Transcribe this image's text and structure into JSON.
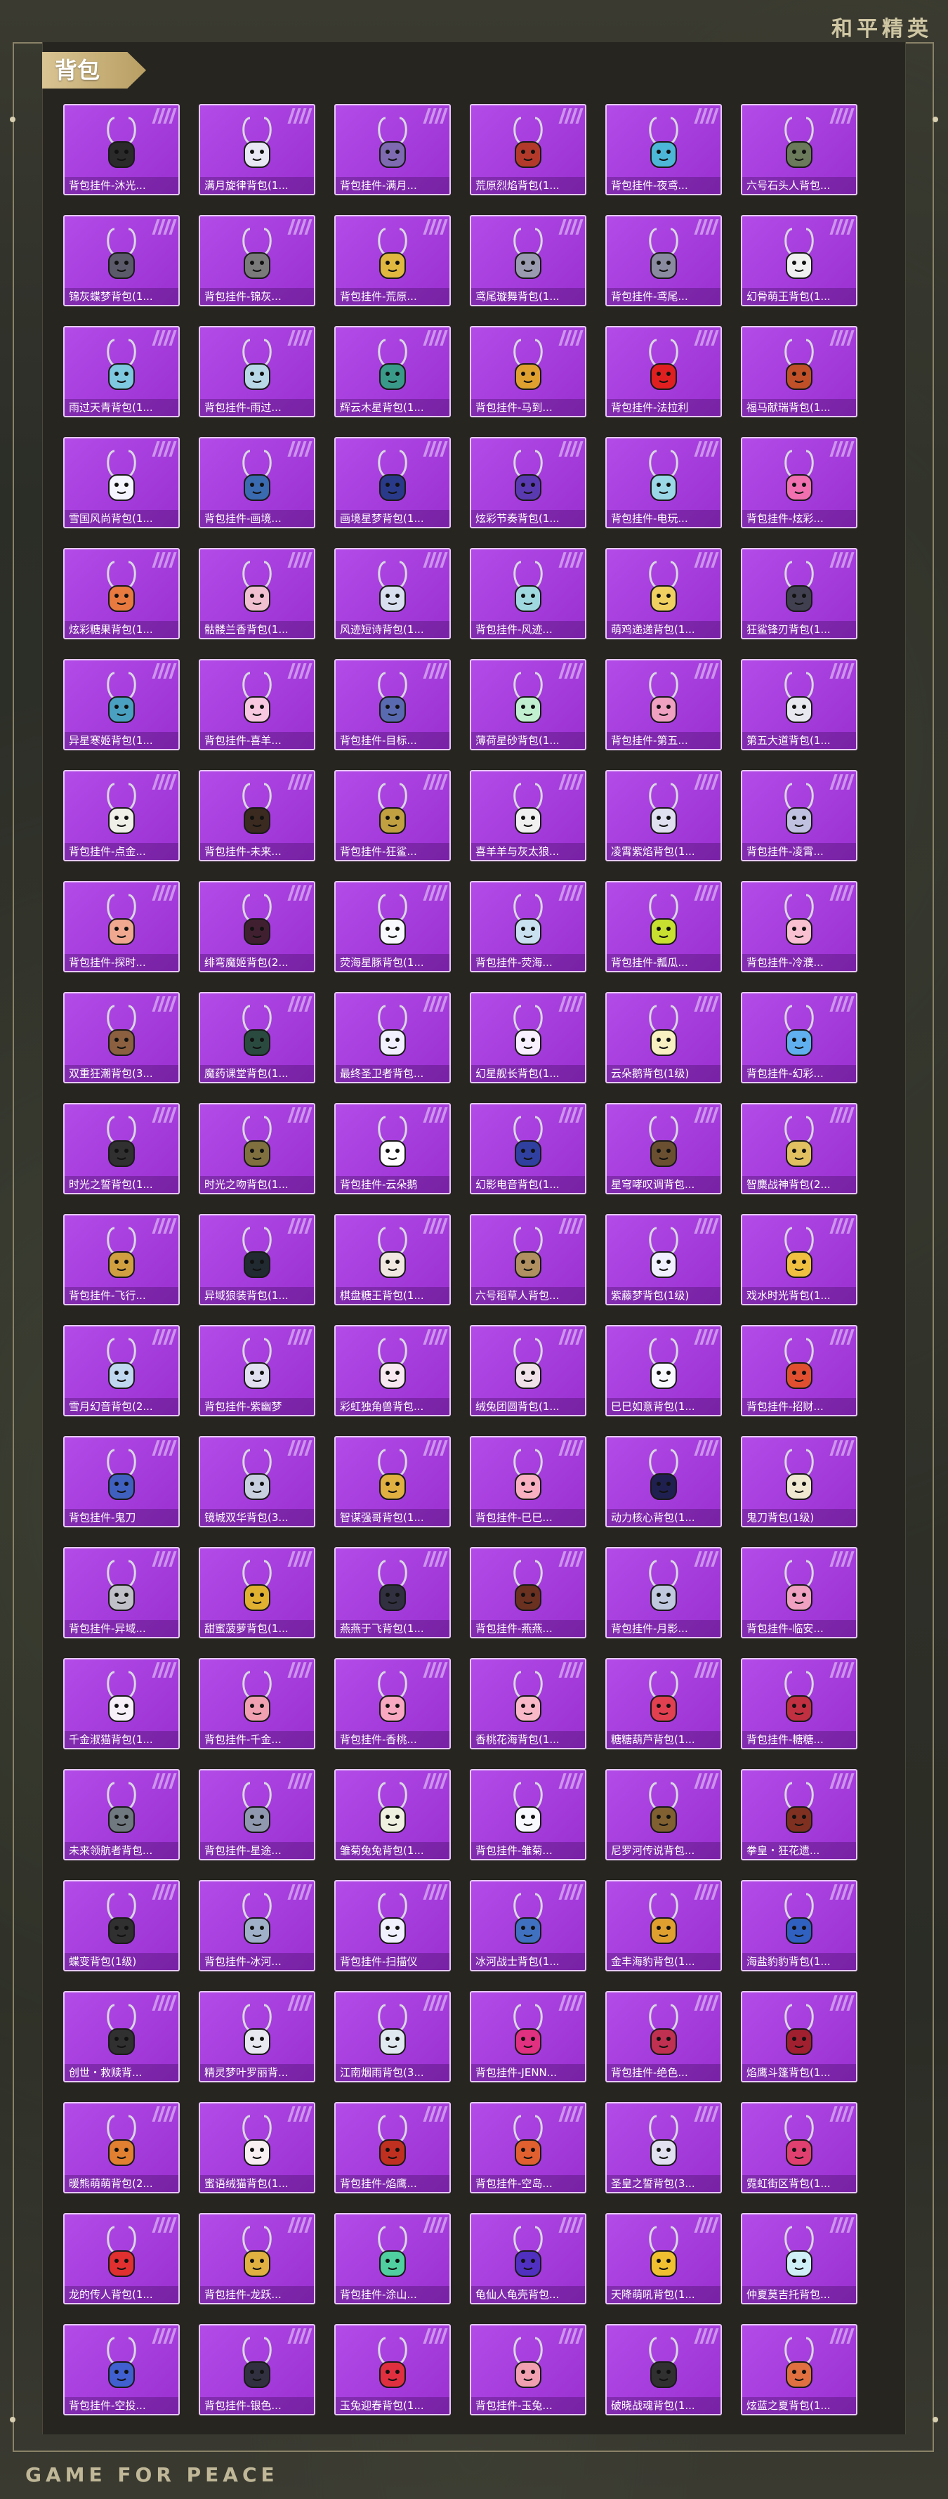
{
  "brand": {
    "cn_title": "和平精英",
    "en_footer": "GAME FOR PEACE"
  },
  "section": {
    "title": "背包"
  },
  "colors": {
    "card_purple": "#a53cdc",
    "card_border": "#e7c8f6",
    "title_gold": "#d9c493"
  },
  "items": [
    {
      "label": "背包挂件-沐光...",
      "icon": "cat-charm-icon",
      "tint": "#2a2a2a"
    },
    {
      "label": "满月旋律背包(1...",
      "icon": "moon-charm-icon",
      "tint": "#e8e8f5"
    },
    {
      "label": "背包挂件-满月...",
      "icon": "ring-charm-icon",
      "tint": "#7e6ab0"
    },
    {
      "label": "荒原烈焰背包(1...",
      "icon": "flame-backpack-icon",
      "tint": "#b33a2a"
    },
    {
      "label": "背包挂件-夜鸢...",
      "icon": "bird-charm-icon",
      "tint": "#4db7d8"
    },
    {
      "label": "六号石头人背包...",
      "icon": "stone-golem-icon",
      "tint": "#6a7a5a"
    },
    {
      "label": "锦灰蝶梦背包(1...",
      "icon": "butterfly-charm-icon",
      "tint": "#5a5a6a"
    },
    {
      "label": "背包挂件-锦灰...",
      "icon": "hook-charm-icon",
      "tint": "#7a7a7a"
    },
    {
      "label": "背包挂件-荒原...",
      "icon": "star-charm-icon",
      "tint": "#e0b840"
    },
    {
      "label": "鸢尾璇舞背包(1...",
      "icon": "blade-charm-icon",
      "tint": "#9a9ab0"
    },
    {
      "label": "背包挂件-鸢尾...",
      "icon": "feather-charm-icon",
      "tint": "#8a8aa0"
    },
    {
      "label": "幻骨萌王背包(1...",
      "icon": "skull-charm-icon",
      "tint": "#f0f0f0"
    },
    {
      "label": "雨过天青背包(1...",
      "icon": "shell-charm-icon",
      "tint": "#7ec8e0"
    },
    {
      "label": "背包挂件-雨过...",
      "icon": "sword-charm-icon",
      "tint": "#b8d8e8"
    },
    {
      "label": "辉云木星背包(1...",
      "icon": "bunny-charm-icon",
      "tint": "#3a9a8a"
    },
    {
      "label": "背包挂件-马到...",
      "icon": "horse-charm-icon",
      "tint": "#e0a030"
    },
    {
      "label": "背包挂件-法拉利",
      "icon": "ferrari-badge-icon",
      "tint": "#e02020"
    },
    {
      "label": "福马献瑞背包(1...",
      "icon": "horse-bag-icon",
      "tint": "#c05028"
    },
    {
      "label": "雪国风尚背包(1...",
      "icon": "snow-bunny-icon",
      "tint": "#f5f5ff"
    },
    {
      "label": "背包挂件-画境...",
      "icon": "brush-charm-icon",
      "tint": "#3a6ab0"
    },
    {
      "label": "画境星梦背包(1...",
      "icon": "starry-bag-icon",
      "tint": "#2a3a8a"
    },
    {
      "label": "炫彩节奏背包(1...",
      "icon": "rhythm-bag-icon",
      "tint": "#5a3ab0"
    },
    {
      "label": "背包挂件-电玩...",
      "icon": "gameboy-charm-icon",
      "tint": "#9ad8e8"
    },
    {
      "label": "背包挂件-炫彩...",
      "icon": "candy-charm-icon",
      "tint": "#f070b0"
    },
    {
      "label": "炫彩糖果背包(1...",
      "icon": "donut-bag-icon",
      "tint": "#e87a40"
    },
    {
      "label": "骷髅兰香背包(1...",
      "icon": "flower-bag-icon",
      "tint": "#f0c0d0"
    },
    {
      "label": "风迹短诗背包(1...",
      "icon": "poem-bag-icon",
      "tint": "#d8e0f0"
    },
    {
      "label": "背包挂件-风迹...",
      "icon": "crystal-charm-icon",
      "tint": "#a0d8e0"
    },
    {
      "label": "萌鸡递递背包(1...",
      "icon": "chick-bag-icon",
      "tint": "#f0d060"
    },
    {
      "label": "狂鲨锋刃背包(1...",
      "icon": "shark-bag-icon",
      "tint": "#404050"
    },
    {
      "label": "异星寒姬背包(1...",
      "icon": "ice-bag-icon",
      "tint": "#4aa0c0"
    },
    {
      "label": "背包挂件-喜羊...",
      "icon": "bow-charm-icon",
      "tint": "#f8c8e0"
    },
    {
      "label": "背包挂件-目标...",
      "icon": "target-charm-icon",
      "tint": "#5a6ab0"
    },
    {
      "label": "薄荷星砂背包(1...",
      "icon": "mint-bag-icon",
      "tint": "#c0f0d0"
    },
    {
      "label": "背包挂件-第五...",
      "icon": "pink-charm-icon",
      "tint": "#f0a0c0"
    },
    {
      "label": "第五大道背包(1...",
      "icon": "avenue-bag-icon",
      "tint": "#e8e8f0"
    },
    {
      "label": "背包挂件-点金...",
      "icon": "mask-charm-icon",
      "tint": "#f0f0e8"
    },
    {
      "label": "背包挂件-未来...",
      "icon": "pumpkin-charm-icon",
      "tint": "#3a2a20"
    },
    {
      "label": "背包挂件-狂鲨...",
      "icon": "fin-charm-icon",
      "tint": "#c0a040"
    },
    {
      "label": "喜羊羊与灰太狼...",
      "icon": "sheep-bag-icon",
      "tint": "#f0f0f0"
    },
    {
      "label": "凌霄紫焰背包(1...",
      "icon": "purple-bag-icon",
      "tint": "#e0e0f0"
    },
    {
      "label": "背包挂件-凌霄...",
      "icon": "flame-charm-icon",
      "tint": "#c0c0e0"
    },
    {
      "label": "背包挂件-探时...",
      "icon": "clock-charm-icon",
      "tint": "#f0a890"
    },
    {
      "label": "绯弯魔姬背包(2...",
      "icon": "witch-bag-icon",
      "tint": "#402030"
    },
    {
      "label": "荧海星豚背包(1...",
      "icon": "dolphin-bag-icon",
      "tint": "#f8f8ff"
    },
    {
      "label": "背包挂件-荧海...",
      "icon": "shell-charm-icon",
      "tint": "#c8e0f0"
    },
    {
      "label": "背包挂件-瓢瓜...",
      "icon": "popsicle-charm-icon",
      "tint": "#c8e030"
    },
    {
      "label": "背包挂件-冷濮...",
      "icon": "blossom-charm-icon",
      "tint": "#f8c0d0"
    },
    {
      "label": "双重狂潮背包(3...",
      "icon": "monkey-bag-icon",
      "tint": "#8a6040"
    },
    {
      "label": "魔药课堂背包(1...",
      "icon": "potion-bag-icon",
      "tint": "#2a4a40"
    },
    {
      "label": "最终圣卫者背包...",
      "icon": "guardian-bag-icon",
      "tint": "#f0f0ff"
    },
    {
      "label": "幻星舰长背包(1...",
      "icon": "captain-bag-icon",
      "tint": "#f8f0ff"
    },
    {
      "label": "云朵鹅背包(1级)",
      "icon": "goose-bag-icon",
      "tint": "#f8f0c0"
    },
    {
      "label": "背包挂件-幻彩...",
      "icon": "robot-charm-icon",
      "tint": "#60b0f0"
    },
    {
      "label": "时光之誓背包(1...",
      "icon": "time-bag-icon",
      "tint": "#303030"
    },
    {
      "label": "时光之吻背包(1...",
      "icon": "kiss-bag-icon",
      "tint": "#807040"
    },
    {
      "label": "背包挂件-云朵鹅",
      "icon": "goose-charm-icon",
      "tint": "#ffffff"
    },
    {
      "label": "幻影电音背包(1...",
      "icon": "dj-bag-icon",
      "tint": "#3040a0"
    },
    {
      "label": "星穹哮叹调背包...",
      "icon": "aria-bag-icon",
      "tint": "#6a5030"
    },
    {
      "label": "智麋战神背包(2...",
      "icon": "deer-bag-icon",
      "tint": "#e0c060"
    },
    {
      "label": "背包挂件-飞行...",
      "icon": "plane-charm-icon",
      "tint": "#d0a040"
    },
    {
      "label": "异域狼装背包(1...",
      "icon": "wolf-bag-icon",
      "tint": "#202a30"
    },
    {
      "label": "棋盘糖王背包(1...",
      "icon": "king-bag-icon",
      "tint": "#f0e8e0"
    },
    {
      "label": "六号稻草人背包...",
      "icon": "scarecrow-bag-icon",
      "tint": "#b09060"
    },
    {
      "label": "紫藤梦背包(1级)",
      "icon": "wisteria-bag-icon",
      "tint": "#f0f0ff"
    },
    {
      "label": "戏水时光背包(1...",
      "icon": "duck-bag-icon",
      "tint": "#f0c040"
    },
    {
      "label": "雪月幻音背包(2...",
      "icon": "snow-cat-bag-icon",
      "tint": "#c0d8f0"
    },
    {
      "label": "背包挂件-紫幽梦",
      "icon": "bell-charm-icon",
      "tint": "#e0e0f0"
    },
    {
      "label": "彩虹独角兽背包...",
      "icon": "unicorn-bag-icon",
      "tint": "#f8e8f0"
    },
    {
      "label": "绒兔团圆背包(1...",
      "icon": "plush-bunny-icon",
      "tint": "#f0e0e8"
    },
    {
      "label": "巳巳如意背包(1...",
      "icon": "snake-bag-icon",
      "tint": "#f8f8ff"
    },
    {
      "label": "背包挂件-招财...",
      "icon": "lucky-charm-icon",
      "tint": "#e05030"
    },
    {
      "label": "背包挂件-鬼刀",
      "icon": "ghost-blade-icon",
      "tint": "#4060c0"
    },
    {
      "label": "镜城双华背包(3...",
      "icon": "mirror-bag-icon",
      "tint": "#c8d0e0"
    },
    {
      "label": "智谋强哥背包(1...",
      "icon": "bear-bag-icon",
      "tint": "#e0b040"
    },
    {
      "label": "背包挂件-巳巳...",
      "icon": "ribbon-charm-icon",
      "tint": "#f8b0c0"
    },
    {
      "label": "动力核心背包(1...",
      "icon": "core-bag-icon",
      "tint": "#202050"
    },
    {
      "label": "鬼刀背包(1级)",
      "icon": "ghost-bag-icon",
      "tint": "#f0e8d0"
    },
    {
      "label": "背包挂件-异域...",
      "icon": "claw-charm-icon",
      "tint": "#c0c0c8"
    },
    {
      "label": "甜蜜菠萝背包(1...",
      "icon": "pineapple-bag-icon",
      "tint": "#e0b030"
    },
    {
      "label": "燕燕于飞背包(1...",
      "icon": "swallow-bag-icon",
      "tint": "#303040"
    },
    {
      "label": "背包挂件-燕燕...",
      "icon": "swallow-charm-icon",
      "tint": "#6a3020"
    },
    {
      "label": "背包挂件-月影...",
      "icon": "moon-blade-icon",
      "tint": "#c0c8e0"
    },
    {
      "label": "背包挂件-临安...",
      "icon": "fan-charm-icon",
      "tint": "#f0a0c0"
    },
    {
      "label": "千金淑猫背包(1...",
      "icon": "cat-bag-icon",
      "tint": "#f8f0f8"
    },
    {
      "label": "背包挂件-千金...",
      "icon": "cat-tail-icon",
      "tint": "#f0a0b0"
    },
    {
      "label": "背包挂件-香桃...",
      "icon": "peach-charm-icon",
      "tint": "#f8a8c0"
    },
    {
      "label": "香桃花海背包(1...",
      "icon": "peach-bag-icon",
      "tint": "#f8b8c8"
    },
    {
      "label": "糖糖葫芦背包(1...",
      "icon": "hulu-bag-icon",
      "tint": "#e04050"
    },
    {
      "label": "背包挂件-糖糖...",
      "icon": "sugar-charm-icon",
      "tint": "#c03040"
    },
    {
      "label": "未来领航者背包...",
      "icon": "navigator-bag-icon",
      "tint": "#707880"
    },
    {
      "label": "背包挂件-星途...",
      "icon": "star-path-icon",
      "tint": "#9098b0"
    },
    {
      "label": "雏菊兔兔背包(1...",
      "icon": "daisy-bunny-icon",
      "tint": "#f0f0e0"
    },
    {
      "label": "背包挂件-雏菊...",
      "icon": "daisy-charm-icon",
      "tint": "#f8f8ff"
    },
    {
      "label": "尼罗河传说背包...",
      "icon": "nile-bag-icon",
      "tint": "#806030"
    },
    {
      "label": "拳皇・狂花遗...",
      "icon": "kof-bag-icon",
      "tint": "#803020"
    },
    {
      "label": "蝶变背包(1级)",
      "icon": "butterfly-bag-icon",
      "tint": "#303030"
    },
    {
      "label": "背包挂件-冰河...",
      "icon": "ice-blade-icon",
      "tint": "#a0b0c8"
    },
    {
      "label": "背包挂件-扫描仪",
      "icon": "scanner-charm-icon",
      "tint": "#f0f0ff"
    },
    {
      "label": "冰河战士背包(1...",
      "icon": "ice-warrior-icon",
      "tint": "#4070c0"
    },
    {
      "label": "金丰海豹背包(1...",
      "icon": "seal-bag-icon",
      "tint": "#e0a030"
    },
    {
      "label": "海盐豹豹背包(1...",
      "icon": "leopard-bag-icon",
      "tint": "#3060c0"
    },
    {
      "label": "创世・救赎背...",
      "icon": "genesis-bag-icon",
      "tint": "#303030"
    },
    {
      "label": "精灵梦叶罗丽背...",
      "icon": "fairy-bag-icon",
      "tint": "#e8e8f0"
    },
    {
      "label": "江南烟雨背包(3...",
      "icon": "rain-bag-icon",
      "tint": "#e0e8f0"
    },
    {
      "label": "背包挂件-JENN...",
      "icon": "lips-charm-icon",
      "tint": "#e03080"
    },
    {
      "label": "背包挂件-绝色...",
      "icon": "rose-charm-icon",
      "tint": "#c03050"
    },
    {
      "label": "焰鹰斗篷背包(1...",
      "icon": "hawk-bag-icon",
      "tint": "#a02030"
    },
    {
      "label": "暖熊萌萌背包(2...",
      "icon": "fox-bag-icon",
      "tint": "#e08030"
    },
    {
      "label": "蜜语绒猫背包(1...",
      "icon": "honey-cat-icon",
      "tint": "#f8f0f0"
    },
    {
      "label": "背包挂件-焰鹰...",
      "icon": "hawk-charm-icon",
      "tint": "#c03020"
    },
    {
      "label": "背包挂件-空岛...",
      "icon": "sky-island-icon",
      "tint": "#e06030"
    },
    {
      "label": "圣皇之誓背包(3...",
      "icon": "emperor-bag-icon",
      "tint": "#e0e0f0"
    },
    {
      "label": "霓虹街区背包(1...",
      "icon": "neon-bag-icon",
      "tint": "#e04070"
    },
    {
      "label": "龙的传人背包(1...",
      "icon": "dragon-bag-icon",
      "tint": "#e03030"
    },
    {
      "label": "背包挂件-龙跃...",
      "icon": "dragon-charm-icon",
      "tint": "#e0b040"
    },
    {
      "label": "背包挂件-涂山...",
      "icon": "spirit-charm-icon",
      "tint": "#50d0a0"
    },
    {
      "label": "龟仙人龟壳背包...",
      "icon": "turtle-shell-icon",
      "tint": "#5030c0"
    },
    {
      "label": "天降萌吼背包(1...",
      "icon": "roar-bag-icon",
      "tint": "#f0c030"
    },
    {
      "label": "仲夏莫吉托背包...",
      "icon": "mojito-bag-icon",
      "tint": "#d0f0f8"
    },
    {
      "label": "背包挂件-空投...",
      "icon": "airdrop-charm-icon",
      "tint": "#4060d0"
    },
    {
      "label": "背包挂件-银色...",
      "icon": "silver-charm-icon",
      "tint": "#303040"
    },
    {
      "label": "玉兔迎春背包(1...",
      "icon": "rabbit-bag-icon",
      "tint": "#e03040"
    },
    {
      "label": "背包挂件-玉兔...",
      "icon": "rabbit-charm-icon",
      "tint": "#f0a0b0"
    },
    {
      "label": "破晓战魂背包(1...",
      "icon": "dawn-bag-icon",
      "tint": "#303030"
    },
    {
      "label": "炫蓝之夏背包(1...",
      "icon": "summer-bag-icon",
      "tint": "#e07040"
    }
  ]
}
